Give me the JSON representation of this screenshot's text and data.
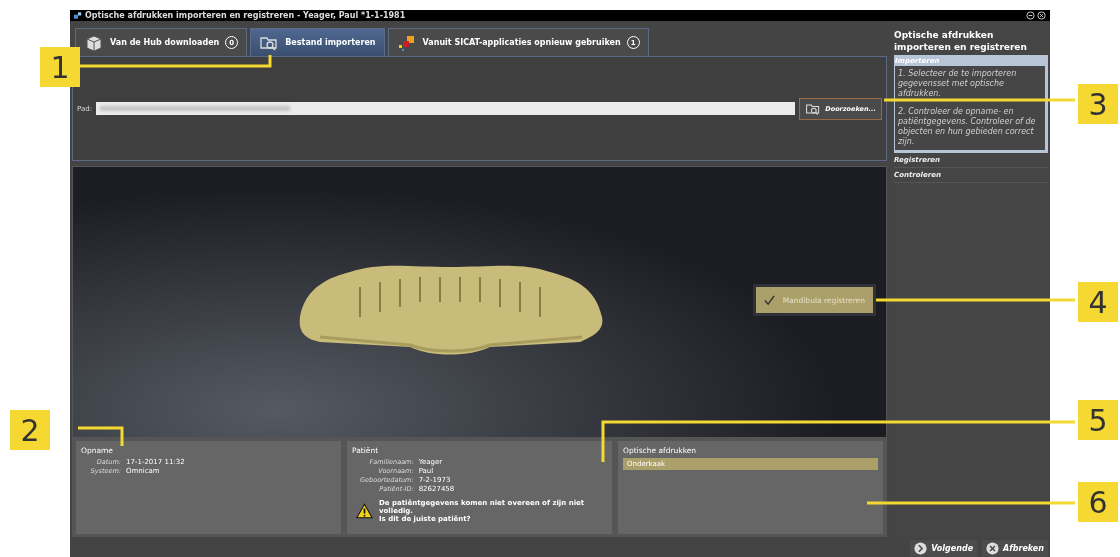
{
  "window": {
    "title": "Optische afdrukken importeren en registreren - Yeager, Paul *1-1-1981"
  },
  "tabs": [
    {
      "label": "Van de Hub downloaden",
      "badge": "0",
      "selected": false
    },
    {
      "label": "Bestand importeren",
      "selected": true
    },
    {
      "label": "Vanuit SICAT-applicaties opnieuw gebruiken",
      "badge": "1",
      "selected": false
    }
  ],
  "import": {
    "path_label": "Pad:",
    "browse_button": "Doorzoeken..."
  },
  "viewer": {
    "register_toggle": {
      "label": "Mandibula registreren",
      "checked": true
    }
  },
  "recording": {
    "title": "Opname",
    "fields": [
      {
        "label": "Datum:",
        "value": "17-1-2017 11:32"
      },
      {
        "label": "Systeem:",
        "value": "Omnicam"
      }
    ]
  },
  "patient": {
    "title": "Patiënt",
    "fields": [
      {
        "label": "Familienaam:",
        "value": "Yeager"
      },
      {
        "label": "Voornaam:",
        "value": "Paul"
      },
      {
        "label": "Geboortedatum:",
        "value": "7-2-1973"
      },
      {
        "label": "Patiënt-ID:",
        "value": "82627458"
      }
    ],
    "warning": "De patiëntgegevens komen niet overeen of zijn niet volledig.\nIs dit de juiste patiënt?"
  },
  "impressions": {
    "title": "Optische afdrukken",
    "items": [
      {
        "label": "Onderkaak",
        "selected": true
      }
    ]
  },
  "sidebar": {
    "title": "Optische afdrukken importeren en registreren",
    "steps": [
      {
        "label": "Importeren",
        "expanded": true,
        "instructions": [
          "1. Selecteer de te importeren gegevensset met optische afdrukken.",
          "2. Controleer de opname- en patiëntgegevens. Controleer of de objecten en hun gebieden correct zijn."
        ]
      },
      {
        "label": "Registreren",
        "expanded": false
      },
      {
        "label": "Controleren",
        "expanded": false
      }
    ]
  },
  "buttons": [
    {
      "label": "Volgende"
    },
    {
      "label": "Afbreken"
    }
  ],
  "callouts": [
    "1",
    "2",
    "3",
    "4",
    "5",
    "6"
  ]
}
